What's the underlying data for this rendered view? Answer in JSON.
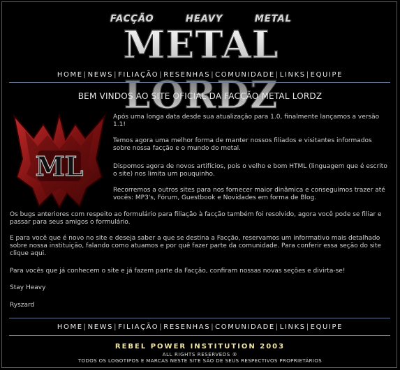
{
  "logo": {
    "sub_words": [
      "FACÇÃO",
      "HEAVY",
      "METAL"
    ],
    "main_text": "METAL LORDZ",
    "emblem_letters": "ML"
  },
  "nav": [
    "HOME",
    "NEWS",
    "FILIAÇÃO",
    "RESENHAS",
    "COMUNIDADE",
    "LINKS",
    "EQUIPE"
  ],
  "nav_separator": "|",
  "welcome_title": "BEM VINDOS AO SITE OFICIAL DA FACÇÃO METAL LORDZ",
  "paragraphs_right": [
    "Após uma longa data desde sua atualização para 1.0, finalmente lançamos a versão 1.1!",
    "Temos agora uma melhor forma de manter nossos filiados e visitantes informados sobre nossa facção e o mundo do metal.",
    "Dispomos agora de novos artifícios, pois o velho e bom HTML (linguagem que é escrito o site) nos limita um pouquinho.",
    "Recorremos a outros sites para nos fornecer maior dinâmica e conseguimos trazer até vocês: MP3's, Fórum, Guestbook e Novidades em forma de Blog."
  ],
  "paragraphs_full": [
    "Os bugs anteriores com respeito ao formulário para filiação à facção também foi resolvido, agora você pode se filiar e passar para seus amigos o formulário.",
    "E para você que é novo no site e deseja saber a que se destina a Facção, reservamos um informativo mais detalhado sobre nossa instituição, falando como atuamos e por quê fazer parte da comunidade. Para conferir essa seção do site clique aqui.",
    "Para vocês que já conhecem o site e já fazem parte da Facção, confiram nossas novas seções e divirta-se!",
    "Stay Heavy",
    "Ryszard"
  ],
  "footer": {
    "org": "REBEL POWER INSTITUTION 2003",
    "rights": "ALL RIGHTS RESERVEDS ®",
    "trademarks": "TODOS OS LOGOTIPOS E MARCAS NESTE SITE SÃO DE SEUS RESPECTIVOS PROPRIETÁRIOS"
  },
  "colors": {
    "background": "#000000",
    "text": "#d2d2d2",
    "rule": "#6b7d96",
    "emblem_red": "#8e1a1a",
    "footer_gold": "#f2e6a0"
  }
}
